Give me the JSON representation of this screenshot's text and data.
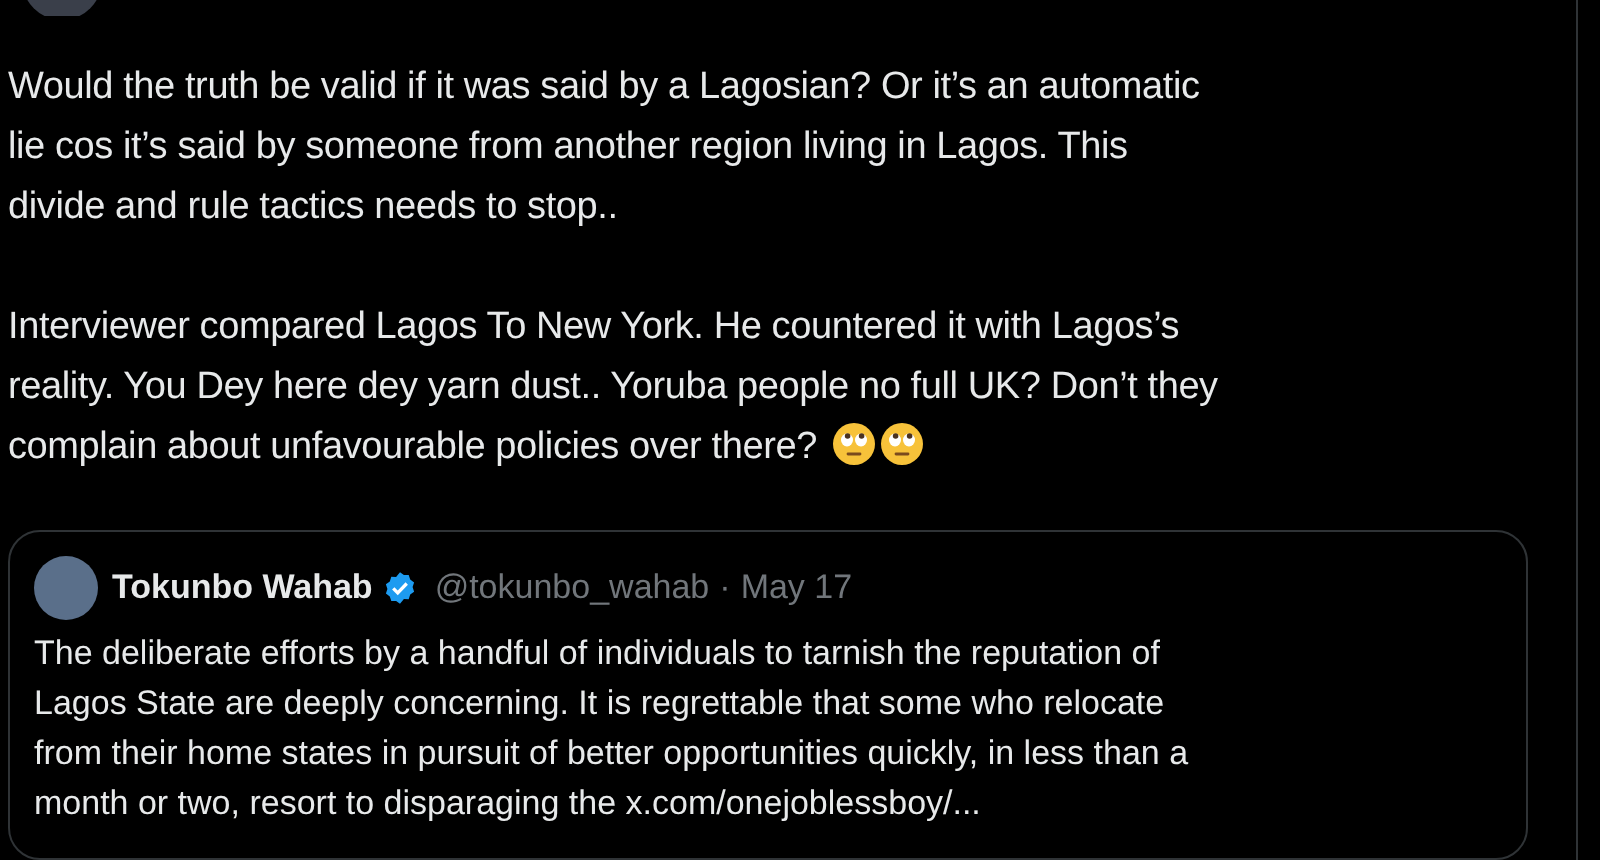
{
  "post": {
    "paragraphs": [
      [
        "Would the truth be valid if it was said by a Lagosian? Or it’s an automatic",
        "lie cos it’s said by someone from another region living in Lagos. This",
        "divide and rule tactics needs to stop.."
      ],
      [
        "Interviewer compared Lagos To New York. He countered it with Lagos’s",
        "reality. You Dey here dey yarn dust.. Yoruba people no full UK? Don’t they",
        "complain about unfavourable policies over there?"
      ]
    ],
    "trailing_emojis": [
      {
        "kind": "rolling-eyes"
      },
      {
        "kind": "rolling-eyes"
      }
    ]
  },
  "quote": {
    "name": "Tokunbo Wahab",
    "verified": true,
    "handle": "@tokunbo_wahab",
    "separator": "·",
    "date": "May 17",
    "lines": [
      "The deliberate efforts by a handful of individuals to tarnish the reputation of",
      "Lagos State are deeply concerning. It is regrettable that some who relocate",
      "from their home states in pursuit of better opportunities quickly, in less than a",
      "month or two, resort to disparaging the x.com/onejoblessboy/..."
    ]
  }
}
